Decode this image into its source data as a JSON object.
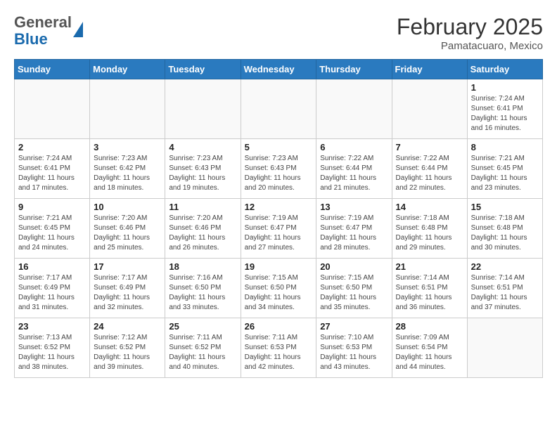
{
  "logo": {
    "general": "General",
    "blue": "Blue"
  },
  "header": {
    "month": "February 2025",
    "location": "Pamatacuaro, Mexico"
  },
  "days_of_week": [
    "Sunday",
    "Monday",
    "Tuesday",
    "Wednesday",
    "Thursday",
    "Friday",
    "Saturday"
  ],
  "weeks": [
    [
      {
        "day": "",
        "info": ""
      },
      {
        "day": "",
        "info": ""
      },
      {
        "day": "",
        "info": ""
      },
      {
        "day": "",
        "info": ""
      },
      {
        "day": "",
        "info": ""
      },
      {
        "day": "",
        "info": ""
      },
      {
        "day": "1",
        "info": "Sunrise: 7:24 AM\nSunset: 6:41 PM\nDaylight: 11 hours and 16 minutes."
      }
    ],
    [
      {
        "day": "2",
        "info": "Sunrise: 7:24 AM\nSunset: 6:41 PM\nDaylight: 11 hours and 17 minutes."
      },
      {
        "day": "3",
        "info": "Sunrise: 7:23 AM\nSunset: 6:42 PM\nDaylight: 11 hours and 18 minutes."
      },
      {
        "day": "4",
        "info": "Sunrise: 7:23 AM\nSunset: 6:43 PM\nDaylight: 11 hours and 19 minutes."
      },
      {
        "day": "5",
        "info": "Sunrise: 7:23 AM\nSunset: 6:43 PM\nDaylight: 11 hours and 20 minutes."
      },
      {
        "day": "6",
        "info": "Sunrise: 7:22 AM\nSunset: 6:44 PM\nDaylight: 11 hours and 21 minutes."
      },
      {
        "day": "7",
        "info": "Sunrise: 7:22 AM\nSunset: 6:44 PM\nDaylight: 11 hours and 22 minutes."
      },
      {
        "day": "8",
        "info": "Sunrise: 7:21 AM\nSunset: 6:45 PM\nDaylight: 11 hours and 23 minutes."
      }
    ],
    [
      {
        "day": "9",
        "info": "Sunrise: 7:21 AM\nSunset: 6:45 PM\nDaylight: 11 hours and 24 minutes."
      },
      {
        "day": "10",
        "info": "Sunrise: 7:20 AM\nSunset: 6:46 PM\nDaylight: 11 hours and 25 minutes."
      },
      {
        "day": "11",
        "info": "Sunrise: 7:20 AM\nSunset: 6:46 PM\nDaylight: 11 hours and 26 minutes."
      },
      {
        "day": "12",
        "info": "Sunrise: 7:19 AM\nSunset: 6:47 PM\nDaylight: 11 hours and 27 minutes."
      },
      {
        "day": "13",
        "info": "Sunrise: 7:19 AM\nSunset: 6:47 PM\nDaylight: 11 hours and 28 minutes."
      },
      {
        "day": "14",
        "info": "Sunrise: 7:18 AM\nSunset: 6:48 PM\nDaylight: 11 hours and 29 minutes."
      },
      {
        "day": "15",
        "info": "Sunrise: 7:18 AM\nSunset: 6:48 PM\nDaylight: 11 hours and 30 minutes."
      }
    ],
    [
      {
        "day": "16",
        "info": "Sunrise: 7:17 AM\nSunset: 6:49 PM\nDaylight: 11 hours and 31 minutes."
      },
      {
        "day": "17",
        "info": "Sunrise: 7:17 AM\nSunset: 6:49 PM\nDaylight: 11 hours and 32 minutes."
      },
      {
        "day": "18",
        "info": "Sunrise: 7:16 AM\nSunset: 6:50 PM\nDaylight: 11 hours and 33 minutes."
      },
      {
        "day": "19",
        "info": "Sunrise: 7:15 AM\nSunset: 6:50 PM\nDaylight: 11 hours and 34 minutes."
      },
      {
        "day": "20",
        "info": "Sunrise: 7:15 AM\nSunset: 6:50 PM\nDaylight: 11 hours and 35 minutes."
      },
      {
        "day": "21",
        "info": "Sunrise: 7:14 AM\nSunset: 6:51 PM\nDaylight: 11 hours and 36 minutes."
      },
      {
        "day": "22",
        "info": "Sunrise: 7:14 AM\nSunset: 6:51 PM\nDaylight: 11 hours and 37 minutes."
      }
    ],
    [
      {
        "day": "23",
        "info": "Sunrise: 7:13 AM\nSunset: 6:52 PM\nDaylight: 11 hours and 38 minutes."
      },
      {
        "day": "24",
        "info": "Sunrise: 7:12 AM\nSunset: 6:52 PM\nDaylight: 11 hours and 39 minutes."
      },
      {
        "day": "25",
        "info": "Sunrise: 7:11 AM\nSunset: 6:52 PM\nDaylight: 11 hours and 40 minutes."
      },
      {
        "day": "26",
        "info": "Sunrise: 7:11 AM\nSunset: 6:53 PM\nDaylight: 11 hours and 42 minutes."
      },
      {
        "day": "27",
        "info": "Sunrise: 7:10 AM\nSunset: 6:53 PM\nDaylight: 11 hours and 43 minutes."
      },
      {
        "day": "28",
        "info": "Sunrise: 7:09 AM\nSunset: 6:54 PM\nDaylight: 11 hours and 44 minutes."
      },
      {
        "day": "",
        "info": ""
      }
    ]
  ]
}
